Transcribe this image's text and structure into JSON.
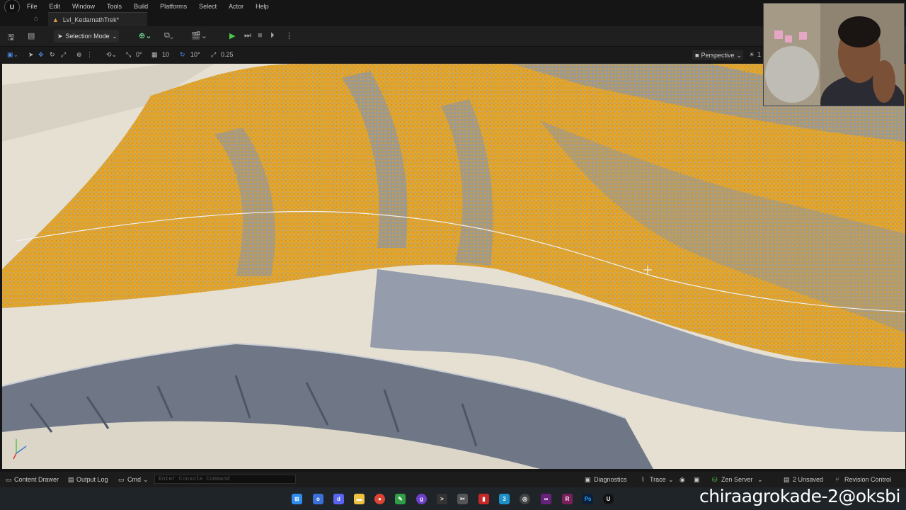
{
  "menu": {
    "logo": "U",
    "items": [
      "File",
      "Edit",
      "Window",
      "Tools",
      "Build",
      "Platforms",
      "Select",
      "Actor",
      "Help"
    ]
  },
  "tab": {
    "level_name": "Lvl_KedarnathTrek*"
  },
  "toolbar": {
    "selection_mode": "Selection Mode"
  },
  "viewport_toolbar": {
    "rot_snap": "0°",
    "grid_snap": "10",
    "angle_snap": "10°",
    "scale_snap": "0.25",
    "view_mode": "Perspective",
    "partial": "1"
  },
  "statusbar": {
    "content_drawer": "Content Drawer",
    "output_log": "Output Log",
    "cmd": "Cmd",
    "console_placeholder": "Enter Console Command",
    "diagnostics": "Diagnostics",
    "trace": "Trace",
    "zen_server": "Zen Server",
    "unsaved": "2 Unsaved",
    "revision_control": "Revision Control"
  },
  "overlay": {
    "watermark": "chiraagrokade-2@oksbi"
  },
  "colors": {
    "foliage": "#e5a320",
    "rock": "#8f98ab",
    "snow": "#e6e0d2"
  }
}
